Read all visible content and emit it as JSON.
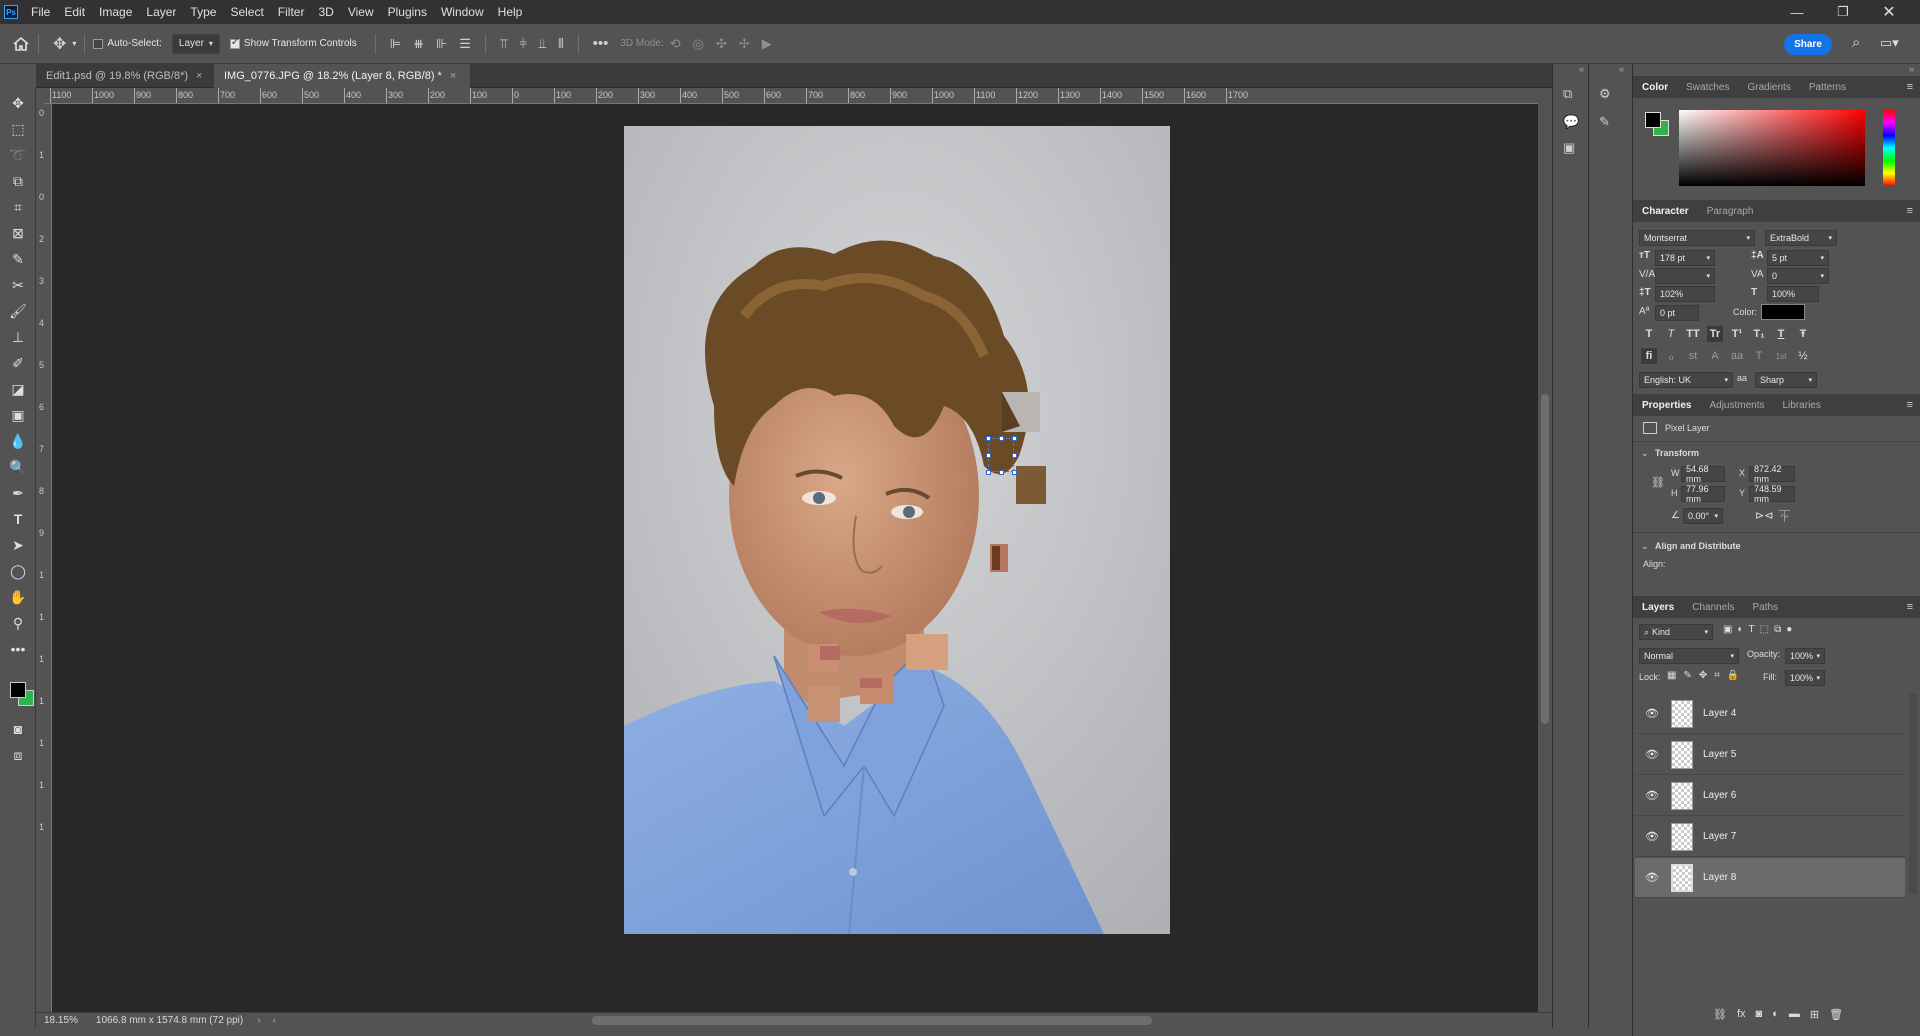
{
  "menubar": {
    "logo": "Ps",
    "items": [
      "File",
      "Edit",
      "Image",
      "Layer",
      "Type",
      "Select",
      "Filter",
      "3D",
      "View",
      "Plugins",
      "Window",
      "Help"
    ]
  },
  "options_bar": {
    "auto_select_label": "Auto-Select:",
    "auto_select_target": "Layer",
    "show_transform_controls_label": "Show Transform Controls",
    "mode_label": "3D Mode:",
    "share_label": "Share"
  },
  "tabs": [
    {
      "label": "Edit1.psd @ 19.8% (RGB/8*)",
      "close": "×"
    },
    {
      "label": "IMG_0776.JPG @ 18.2% (Layer 8, RGB/8) *",
      "close": "×"
    }
  ],
  "ruler_top_labels": [
    "1100",
    "1000",
    "900",
    "800",
    "700",
    "600",
    "500",
    "400",
    "300",
    "200",
    "100",
    "0",
    "100",
    "200",
    "300",
    "400",
    "500",
    "600",
    "700",
    "800",
    "900",
    "1000",
    "1100",
    "1200",
    "1300",
    "1400",
    "1500",
    "1600",
    "1700"
  ],
  "ruler_left_labels": [
    "0",
    "1",
    "0",
    "2",
    "3",
    "4",
    "5",
    "6",
    "7",
    "8",
    "9",
    "1",
    "1",
    "1",
    "1",
    "1",
    "1",
    "1"
  ],
  "status": {
    "zoom": "18.15%",
    "doc_size": "1066.8 mm x 1574.8 mm (72 ppi)"
  },
  "color_panel": {
    "tabs": [
      "Color",
      "Swatches",
      "Gradients",
      "Patterns"
    ],
    "fg": "#000000",
    "bg": "#2fb34a",
    "hue": "#ff0000"
  },
  "character": {
    "tabs": [
      "Character",
      "Paragraph"
    ],
    "font_family": "Montserrat",
    "font_style": "ExtraBold",
    "size": "178 pt",
    "leading": "5 pt",
    "kerning": "",
    "tracking": "0",
    "vscale": "102%",
    "hscale": "100%",
    "baseline": "0 pt",
    "color_label": "Color:",
    "color": "#000000",
    "style_buttons": [
      "T",
      "T",
      "TT",
      "Tr",
      "T¹",
      "T₁",
      "T",
      "Ŧ"
    ],
    "ot_buttons": [
      "fi",
      "ℴ",
      "st",
      "A",
      "aa",
      "T",
      "1st",
      "½"
    ],
    "language": "English: UK",
    "aa_label": "aa",
    "antialias": "Sharp"
  },
  "properties": {
    "tabs": [
      "Properties",
      "Adjustments",
      "Libraries"
    ],
    "layer_type": "Pixel Layer",
    "transform_title": "Transform",
    "w_label": "W",
    "w": "54.68 mm",
    "h_label": "H",
    "h": "77.96 mm",
    "x_label": "X",
    "x": "872.42 mm",
    "y_label": "Y",
    "y": "748.59 mm",
    "angle": "0.00°",
    "align_title": "Align and Distribute",
    "align_label": "Align:"
  },
  "layers": {
    "tabs": [
      "Layers",
      "Channels",
      "Paths"
    ],
    "filter": "Kind",
    "blend_mode": "Normal",
    "opacity_label": "Opacity:",
    "opacity": "100%",
    "lock_label": "Lock:",
    "fill_label": "Fill:",
    "fill": "100%",
    "items": [
      {
        "name": "Layer 4",
        "selected": false
      },
      {
        "name": "Layer 5",
        "selected": false
      },
      {
        "name": "Layer 6",
        "selected": false
      },
      {
        "name": "Layer 7",
        "selected": false
      },
      {
        "name": "Layer 8",
        "selected": true
      }
    ]
  }
}
